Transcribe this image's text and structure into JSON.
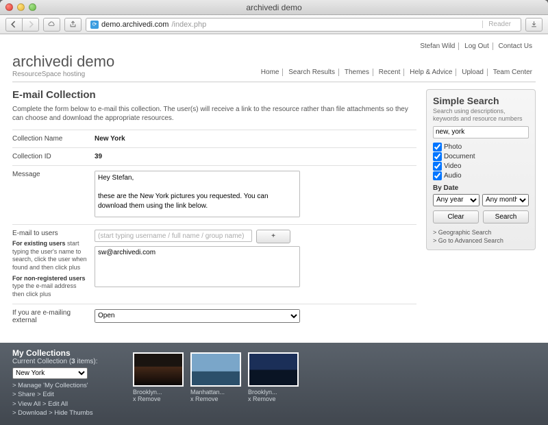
{
  "window": {
    "title": "archivedi demo"
  },
  "browser": {
    "url_domain": "demo.archivedi.com",
    "url_path": "/index.php",
    "reader_label": "Reader"
  },
  "header": {
    "site_title": "archivedi demo",
    "strapline": "ResourceSpace hosting",
    "topnav": [
      "Stefan Wild",
      "Log Out",
      "Contact Us"
    ],
    "secnav": [
      "Home",
      "Search Results",
      "Themes",
      "Recent",
      "Help & Advice",
      "Upload",
      "Team Center"
    ]
  },
  "page": {
    "title": "E-mail Collection",
    "intro": "Complete the form below to e-mail this collection. The user(s) will receive a link to the resource rather than file attachments so they can choose and download the appropriate resources.",
    "rows": {
      "collection_name_label": "Collection Name",
      "collection_name_value": "New York",
      "collection_id_label": "Collection ID",
      "collection_id_value": "39",
      "message_label": "Message",
      "message_value": "Hey Stefan,\n\nthese are the New York pictures you requested. You can download them using the link below.\n\nBest regards",
      "email_users_label": "E-mail to users",
      "user_search_placeholder": "(start typing username / full name / group name)",
      "plus_label": "+",
      "users_value": "sw@archivedi.com",
      "email_help_existing_b": "For existing users",
      "email_help_existing": " start typing the user's name to search, click the user when found and then click plus",
      "email_help_nonreg_b": "For non-registered users",
      "email_help_nonreg": " type the e-mail address then click plus",
      "access_intro": "If you are e-mailing external",
      "access_value": "Open"
    }
  },
  "search": {
    "title": "Simple Search",
    "desc": "Search using descriptions, keywords and resource numbers",
    "query": "new, york",
    "types": [
      {
        "label": "Photo",
        "checked": true
      },
      {
        "label": "Document",
        "checked": true
      },
      {
        "label": "Video",
        "checked": true
      },
      {
        "label": "Audio",
        "checked": true
      }
    ],
    "bydate_label": "By Date",
    "year": "Any year",
    "month": "Any month",
    "clear": "Clear",
    "search_btn": "Search",
    "geo_link": "> Geographic Search",
    "adv_link": "> Go to Advanced Search"
  },
  "footer": {
    "heading": "My Collections",
    "current_label": "Current Collection (",
    "current_count": "3",
    "current_suffix": " items):",
    "collection_selected": "New York",
    "links": [
      "> Manage 'My Collections'",
      "> Share   > Edit",
      "> View All   > Edit All",
      "> Download   > Hide Thumbs"
    ],
    "thumbs": [
      {
        "caption": "Brooklyn...",
        "remove": "x Remove"
      },
      {
        "caption": "Manhattan...",
        "remove": "x Remove"
      },
      {
        "caption": "Brooklyn...",
        "remove": "x Remove"
      }
    ]
  }
}
